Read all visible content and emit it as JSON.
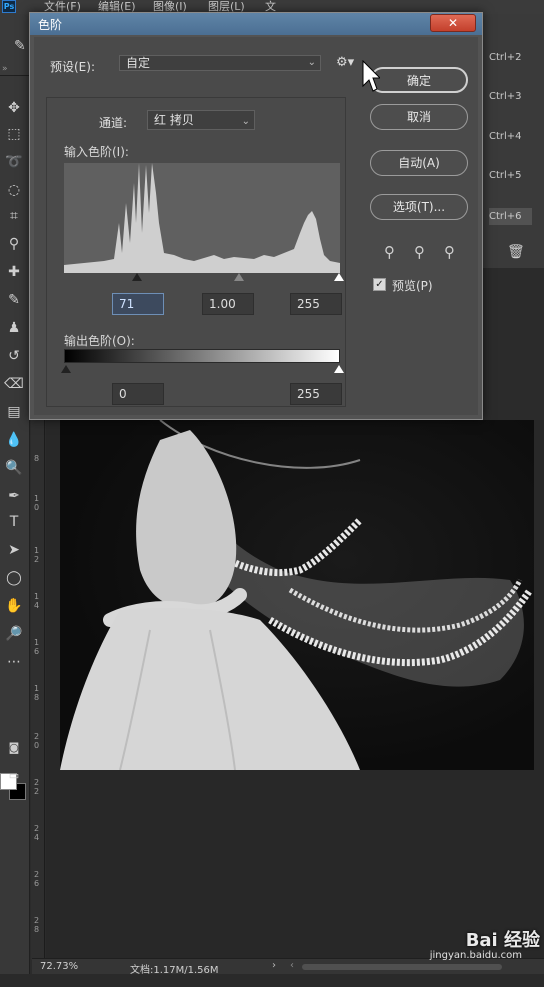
{
  "menubar": {
    "logo": "Ps",
    "items": [
      "文件(F)",
      "编辑(E)",
      "图像(I)",
      "图层(L)",
      "文"
    ]
  },
  "history_shortcuts": [
    "Ctrl+2",
    "Ctrl+3",
    "Ctrl+4",
    "Ctrl+5",
    "Ctrl+6"
  ],
  "dialog": {
    "title": "色阶",
    "preset_label": "预设(E):",
    "preset_value": "自定",
    "channel_label": "通道:",
    "channel_value": "红 拷贝",
    "input_levels_label": "输入色阶(I):",
    "input_black": "71",
    "input_gamma": "1.00",
    "input_white": "255",
    "output_levels_label": "输出色阶(O):",
    "output_black": "0",
    "output_white": "255",
    "buttons": {
      "ok": "确定",
      "cancel": "取消",
      "auto": "自动(A)",
      "options": "选项(T)..."
    },
    "preview_label": "预览(P)",
    "preview_checked": true
  },
  "statusbar": {
    "zoom": "72.73%",
    "doc_info": "文档:1.17M/1.56M"
  },
  "watermark": {
    "brand": "Bai 经验",
    "url": "jingyan.baidu.com"
  },
  "ruler_marks": [
    "8",
    "1 0",
    "1 2",
    "1 4",
    "1 6",
    "1 8",
    "2 0",
    "2 2",
    "2 4",
    "2 6",
    "2 8"
  ]
}
